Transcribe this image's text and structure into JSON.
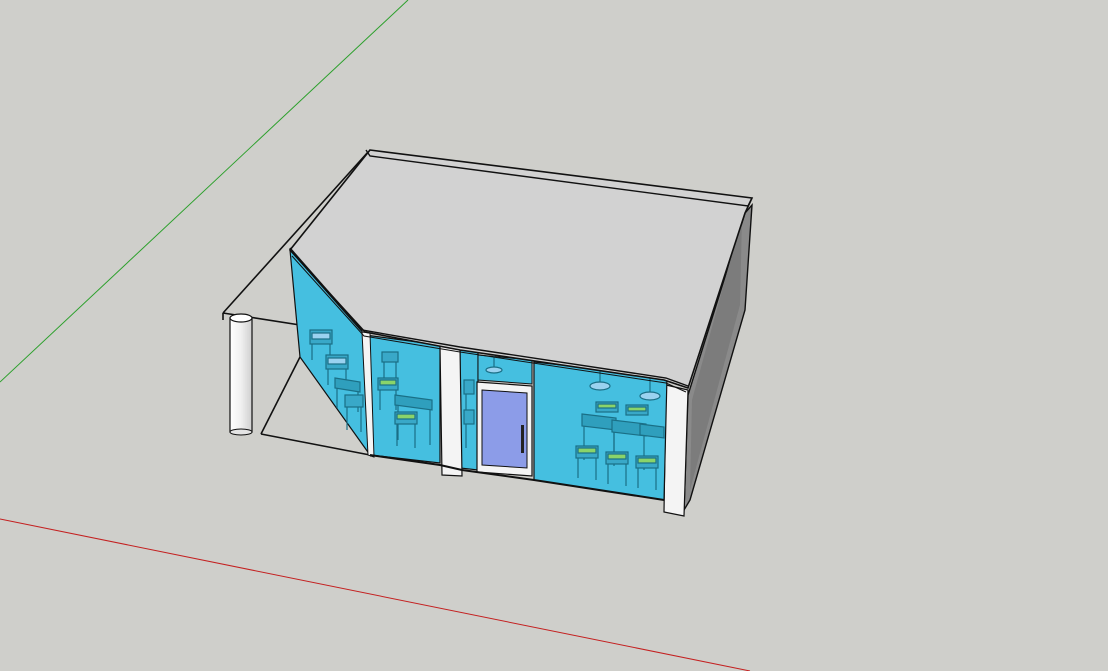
{
  "viewport": {
    "background": "#cfcfcb",
    "axes": {
      "green_axis_color": "#2ca02c",
      "red_axis_color": "#c42020"
    },
    "model": {
      "roof_color": "#d2d2d2",
      "glass_color": "#45bfe0",
      "glass_dark_color": "#2aa8cc",
      "door_glass_color": "#8c9ce8",
      "frame_color": "#f4f4f4",
      "side_wall_color": "#8a8a8a",
      "outline_color": "#111111",
      "chair_seat_color": "#8ad46a"
    },
    "icons": [
      "column-icon",
      "building-icon",
      "door-icon",
      "chair-icon",
      "table-icon",
      "pendant-lamp-icon"
    ]
  }
}
